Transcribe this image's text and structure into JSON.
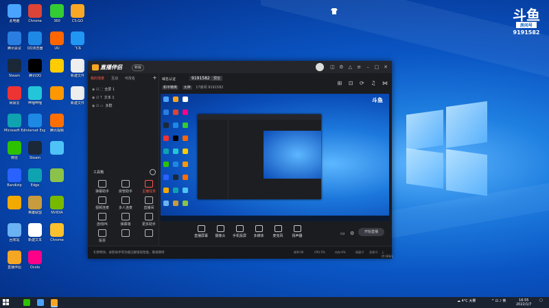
{
  "desktop": {
    "icons": [
      {
        "label": "此电脑",
        "color": "#4aa3ff"
      },
      {
        "label": "腾讯会议",
        "color": "#2a7de1"
      },
      {
        "label": "Steam",
        "color": "#1b2838"
      },
      {
        "label": "网易云",
        "color": "#e33"
      },
      {
        "label": "Microsoft Edge",
        "color": "#0fa3b1"
      },
      {
        "label": "微信",
        "color": "#2dc100"
      },
      {
        "label": "Bandizip",
        "color": "#2962ff"
      },
      {
        "label": "",
        "color": "#f2a900"
      },
      {
        "label": "回收站",
        "color": "#6ab2f2"
      },
      {
        "label": "直播伴侣",
        "color": "#f5a623"
      },
      {
        "label": "Chrome",
        "color": "#db4437"
      },
      {
        "label": "QQ浏览器",
        "color": "#1e88e5"
      },
      {
        "label": "腾讯QQ",
        "color": "#000"
      },
      {
        "label": "哔哩哔哩",
        "color": "#23c6d8"
      },
      {
        "label": "Internet Explorer",
        "color": "#1e88e5"
      },
      {
        "label": "Steam",
        "color": "#1b2838"
      },
      {
        "label": "Edge",
        "color": "#0fa3b1"
      },
      {
        "label": "英雄联盟",
        "color": "#c89b3c"
      },
      {
        "label": "新建文本",
        "color": "#fff"
      },
      {
        "label": "Ocolo",
        "color": "#f08"
      },
      {
        "label": "360",
        "color": "#3c3"
      },
      {
        "label": "UU",
        "color": "#f60"
      },
      {
        "label": "",
        "color": "#ffcc00"
      },
      {
        "label": "",
        "color": "#ff9800"
      },
      {
        "label": "腾讯视频",
        "color": "#ff6f00"
      },
      {
        "label": "",
        "color": "#4fc3f7"
      },
      {
        "label": "",
        "color": "#8bc34a"
      },
      {
        "label": "NVIDIA",
        "color": "#76b900"
      },
      {
        "label": "Chrome",
        "color": "#fbc02d"
      },
      {
        "label": "CS:GO",
        "color": "#f9a825"
      },
      {
        "label": "飞书",
        "color": "#2196f3"
      },
      {
        "label": "新建文件",
        "color": "#eee"
      },
      {
        "label": "新建文件",
        "color": "#eee"
      }
    ]
  },
  "corner_logo": {
    "mark": "斗鱼",
    "label": "房间号",
    "number": "9191582"
  },
  "app": {
    "brand": "直播伴侣",
    "version_pill": "新版",
    "tabs": [
      "我的场景",
      "互动",
      "可改名"
    ],
    "scenes": [
      "全屏 1",
      "文本 1",
      "多群"
    ],
    "tools_header": "工具箱",
    "tools": [
      "弹幕助手",
      "房管助手",
      "主播任务",
      "视频连麦",
      "多人连麦",
      "直播间",
      "连线PK",
      "弹幕墙",
      "更多助手",
      "投票",
      "",
      ""
    ],
    "room_label": "域名认证",
    "room_id": "9191582",
    "room_btn": "预览",
    "sub_tags": [
      "和平精英",
      "大神"
    ],
    "sub_text": "17房间 9191582",
    "controls": [
      "直播屏幕",
      "摄像头",
      "手机投屏",
      "多媒体",
      "麦克风",
      "扬声器"
    ],
    "start_label": "开始直播",
    "status": [
      "礼物特效、录影助手等功能已解锁高性能，敬请期待",
      "帧率:60",
      "CPU:5%",
      "内存:6%",
      "网速:0",
      "丢帧:0",
      "上传:0KB/s"
    ]
  },
  "taskbar": {
    "weather": "4°C 大雾",
    "time": "16:55",
    "date": "2022/1/7"
  }
}
